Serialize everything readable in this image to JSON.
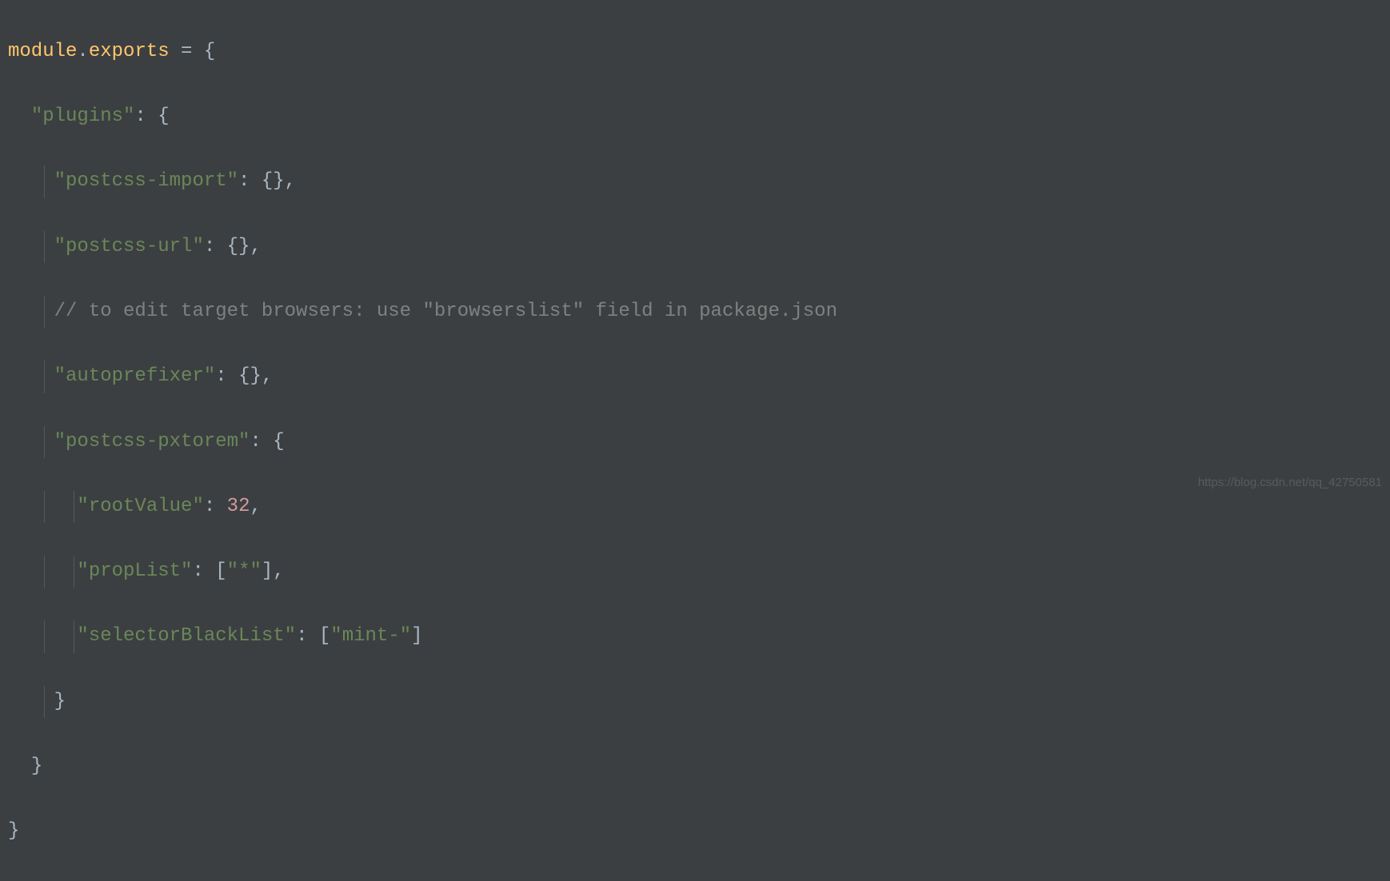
{
  "code": {
    "line1": {
      "module": "module",
      "dot": ".",
      "exports": "exports",
      "equals": " = ",
      "brace": "{"
    },
    "line2": {
      "indent": "  ",
      "key": "\"plugins\"",
      "colon": ": ",
      "brace": "{"
    },
    "line3": {
      "indent": "    ",
      "key": "\"postcss-import\"",
      "colon": ": ",
      "value": "{}",
      "comma": ","
    },
    "line4": {
      "indent": "    ",
      "key": "\"postcss-url\"",
      "colon": ": ",
      "value": "{}",
      "comma": ","
    },
    "line5": {
      "indent": "    ",
      "comment": "// to edit target browsers: use \"browserslist\" field in package.json"
    },
    "line6": {
      "indent": "    ",
      "key": "\"autoprefixer\"",
      "colon": ": ",
      "value": "{}",
      "comma": ","
    },
    "line7": {
      "indent": "    ",
      "key": "\"postcss-pxtorem\"",
      "colon": ": ",
      "brace": "{"
    },
    "line8": {
      "indent": "      ",
      "key": "\"rootValue\"",
      "colon": ": ",
      "value": "32",
      "comma": ","
    },
    "line9": {
      "indent": "      ",
      "key": "\"propList\"",
      "colon": ": ",
      "bracket_open": "[",
      "value": "\"*\"",
      "bracket_close": "]",
      "comma": ","
    },
    "line10": {
      "indent": "      ",
      "key": "\"selectorBlackList\"",
      "colon": ": ",
      "bracket_open": "[",
      "value": "\"mint-\"",
      "bracket_close": "]"
    },
    "line11": {
      "indent": "    ",
      "brace": "}"
    },
    "line12": {
      "indent": "  ",
      "brace": "}"
    },
    "line13": {
      "brace": "}"
    }
  },
  "watermark": "https://blog.csdn.net/qq_42750581"
}
